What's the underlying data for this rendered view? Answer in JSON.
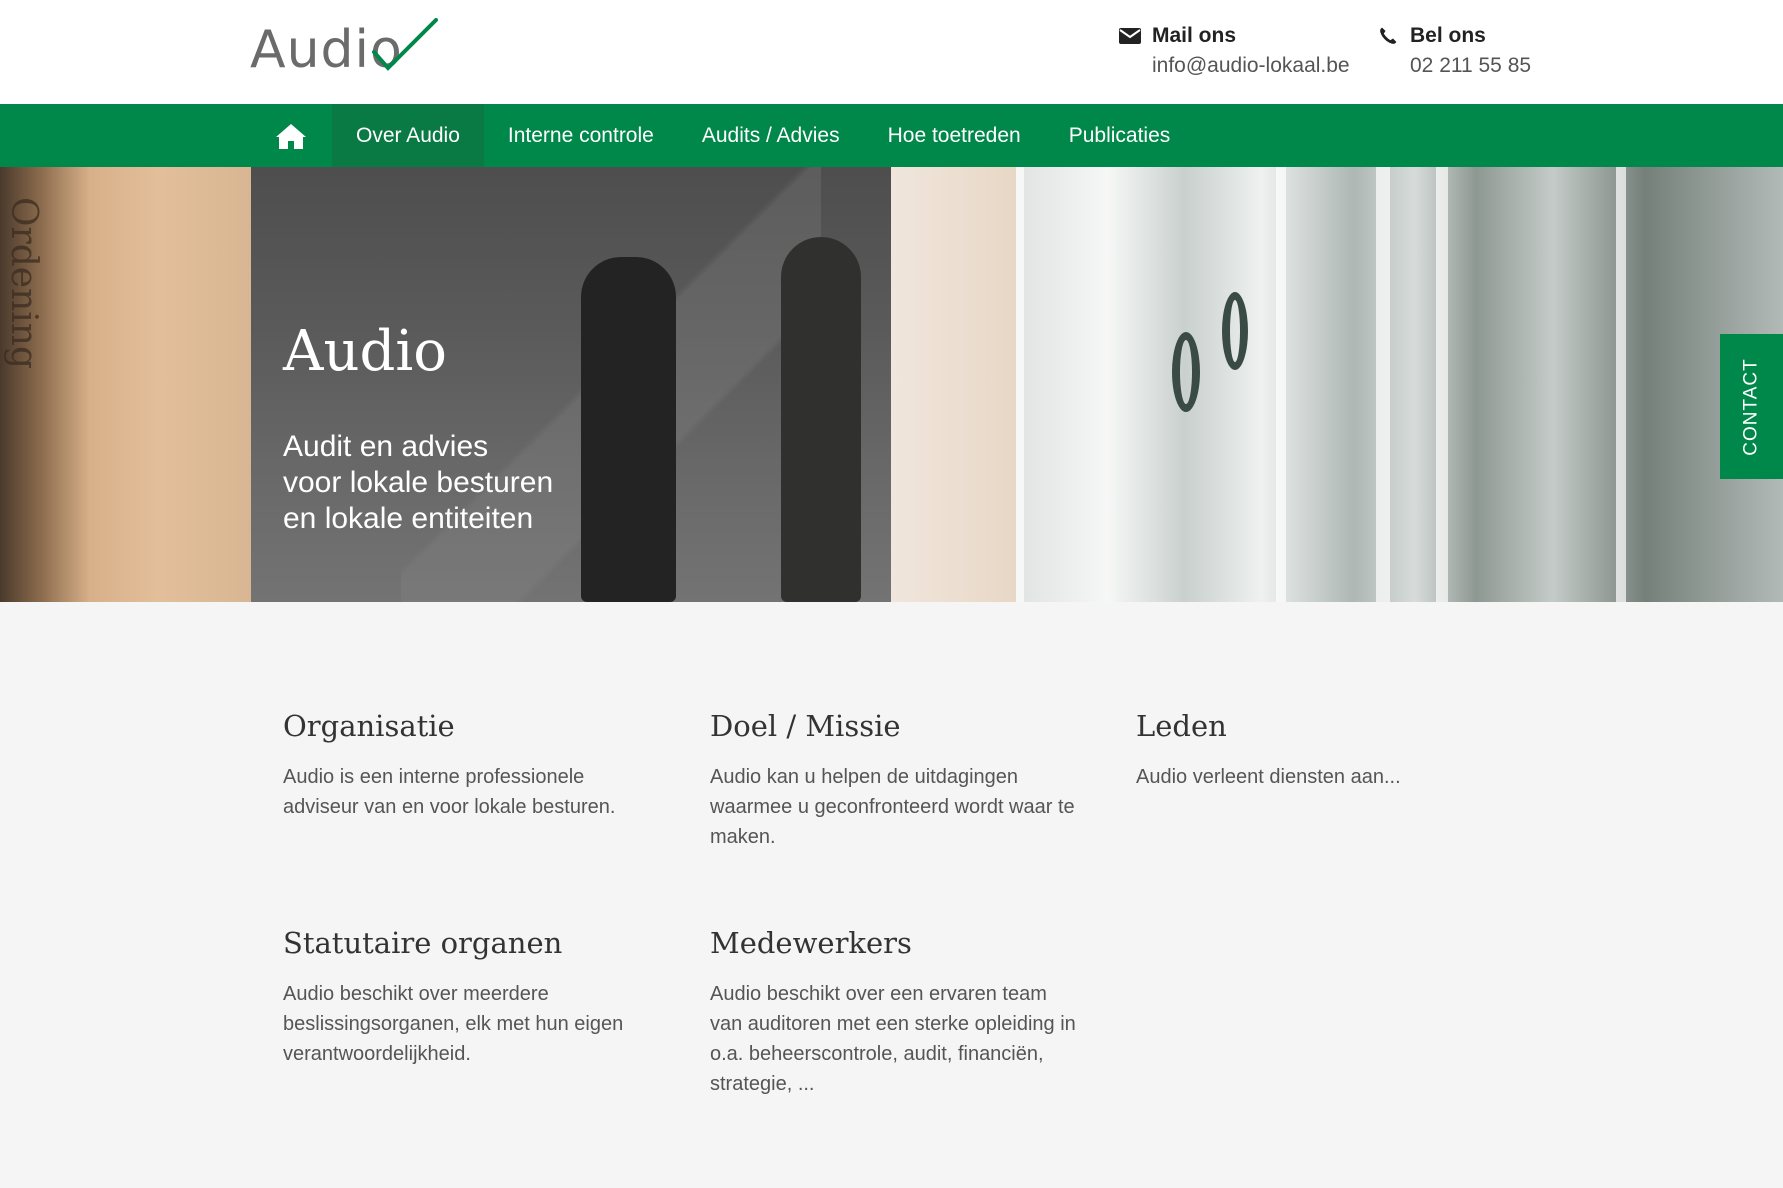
{
  "logo": {
    "text": "Audio",
    "check_color": "#00874a"
  },
  "header": {
    "mail": {
      "title": "Mail ons",
      "value": "info@audio-lokaal.be",
      "icon": "envelope-icon"
    },
    "phone": {
      "title": "Bel ons",
      "value": "02 211 55 85",
      "icon": "phone-icon"
    }
  },
  "nav": {
    "home_icon": "home-icon",
    "items": [
      {
        "label": "Over Audio",
        "active": true
      },
      {
        "label": "Interne controle",
        "active": false
      },
      {
        "label": "Audits / Advies",
        "active": false
      },
      {
        "label": "Hoe toetreden",
        "active": false
      },
      {
        "label": "Publicaties",
        "active": false
      }
    ]
  },
  "hero": {
    "title": "Audio",
    "subtitle_lines": [
      "Audit en advies",
      "voor lokale besturen",
      "en lokale entiteiten"
    ]
  },
  "contact_tab": {
    "label": "CONTACT"
  },
  "cards": [
    {
      "title": "Organisatie",
      "text": "Audio is een interne professionele adviseur van en voor lokale besturen."
    },
    {
      "title": "Doel / Missie",
      "text": "Audio kan u helpen de uitdagingen waarmee u geconfronteerd wordt waar te maken."
    },
    {
      "title": "Leden",
      "text": "Audio verleent diensten aan..."
    },
    {
      "title": "Statutaire organen",
      "text": "Audio beschikt over meerdere beslissingsorganen, elk met hun eigen verantwoordelijkheid."
    },
    {
      "title": "Medewerkers",
      "text": "Audio beschikt over een ervaren team van auditoren met een sterke opleiding in o.a. beheerscontrole, audit, financiën, strategie, ..."
    }
  ],
  "colors": {
    "brand_green": "#00874a",
    "nav_active": "#0a7a45",
    "background": "#f5f5f5"
  }
}
